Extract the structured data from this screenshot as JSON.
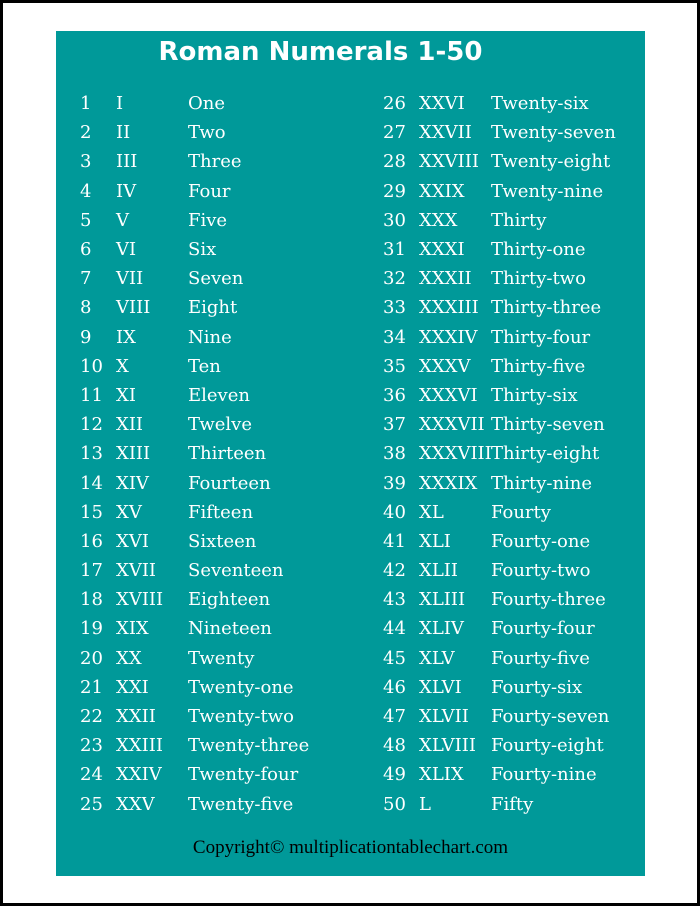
{
  "title": "Roman Numerals 1-50",
  "copyright": "Copyright© multiplicationtablechart.com",
  "colors": {
    "panel": "#009999",
    "text": "#ffffff",
    "border": "#000000"
  },
  "left": [
    {
      "n": "1",
      "r": "I",
      "w": "One"
    },
    {
      "n": "2",
      "r": "II",
      "w": "Two"
    },
    {
      "n": "3",
      "r": "III",
      "w": "Three"
    },
    {
      "n": "4",
      "r": "IV",
      "w": "Four"
    },
    {
      "n": "5",
      "r": "V",
      "w": "Five"
    },
    {
      "n": "6",
      "r": "VI",
      "w": "Six"
    },
    {
      "n": "7",
      "r": "VII",
      "w": "Seven"
    },
    {
      "n": "8",
      "r": "VIII",
      "w": "Eight"
    },
    {
      "n": "9",
      "r": "IX",
      "w": "Nine"
    },
    {
      "n": "10",
      "r": "X",
      "w": "Ten"
    },
    {
      "n": "11",
      "r": "XI",
      "w": "Eleven"
    },
    {
      "n": "12",
      "r": "XII",
      "w": "Twelve"
    },
    {
      "n": "13",
      "r": "XIII",
      "w": "Thirteen"
    },
    {
      "n": "14",
      "r": "XIV",
      "w": "Fourteen"
    },
    {
      "n": "15",
      "r": "XV",
      "w": "Fifteen"
    },
    {
      "n": "16",
      "r": "XVI",
      "w": "Sixteen"
    },
    {
      "n": "17",
      "r": "XVII",
      "w": "Seventeen"
    },
    {
      "n": "18",
      "r": "XVIII",
      "w": "Eighteen"
    },
    {
      "n": "19",
      "r": "XIX",
      "w": "Nineteen"
    },
    {
      "n": "20",
      "r": "XX",
      "w": "Twenty"
    },
    {
      "n": "21",
      "r": "XXI",
      "w": "Twenty-one"
    },
    {
      "n": "22",
      "r": "XXII",
      "w": "Twenty-two"
    },
    {
      "n": "23",
      "r": "XXIII",
      "w": "Twenty-three"
    },
    {
      "n": "24",
      "r": "XXIV",
      "w": "Twenty-four"
    },
    {
      "n": "25",
      "r": "XXV",
      "w": "Twenty-five"
    }
  ],
  "right": [
    {
      "n": "26",
      "r": "XXVI",
      "w": "Twenty-six"
    },
    {
      "n": "27",
      "r": "XXVII",
      "w": "Twenty-seven"
    },
    {
      "n": "28",
      "r": "XXVIII",
      "w": "Twenty-eight"
    },
    {
      "n": "29",
      "r": "XXIX",
      "w": "Twenty-nine"
    },
    {
      "n": "30",
      "r": "XXX",
      "w": "Thirty"
    },
    {
      "n": "31",
      "r": "XXXI",
      "w": "Thirty-one"
    },
    {
      "n": "32",
      "r": "XXXII",
      "w": "Thirty-two"
    },
    {
      "n": "33",
      "r": "XXXIII",
      "w": "Thirty-three"
    },
    {
      "n": "34",
      "r": "XXXIV",
      "w": "Thirty-four"
    },
    {
      "n": "35",
      "r": "XXXV",
      "w": "Thirty-five"
    },
    {
      "n": "36",
      "r": "XXXVI",
      "w": "Thirty-six"
    },
    {
      "n": "37",
      "r": "XXXVII",
      "w": "Thirty-seven"
    },
    {
      "n": "38",
      "r": "XXXVIII",
      "w": "Thirty-eight"
    },
    {
      "n": "39",
      "r": "XXXIX",
      "w": "Thirty-nine"
    },
    {
      "n": "40",
      "r": "XL",
      "w": "Fourty"
    },
    {
      "n": "41",
      "r": "XLI",
      "w": "Fourty-one"
    },
    {
      "n": "42",
      "r": "XLII",
      "w": "Fourty-two"
    },
    {
      "n": "43",
      "r": "XLIII",
      "w": "Fourty-three"
    },
    {
      "n": "44",
      "r": "XLIV",
      "w": "Fourty-four"
    },
    {
      "n": "45",
      "r": "XLV",
      "w": "Fourty-five"
    },
    {
      "n": "46",
      "r": "XLVI",
      "w": "Fourty-six"
    },
    {
      "n": "47",
      "r": "XLVII",
      "w": "Fourty-seven"
    },
    {
      "n": "48",
      "r": "XLVIII",
      "w": "Fourty-eight"
    },
    {
      "n": "49",
      "r": "XLIX",
      "w": "Fourty-nine"
    },
    {
      "n": "50",
      "r": "L",
      "w": "Fifty"
    }
  ]
}
